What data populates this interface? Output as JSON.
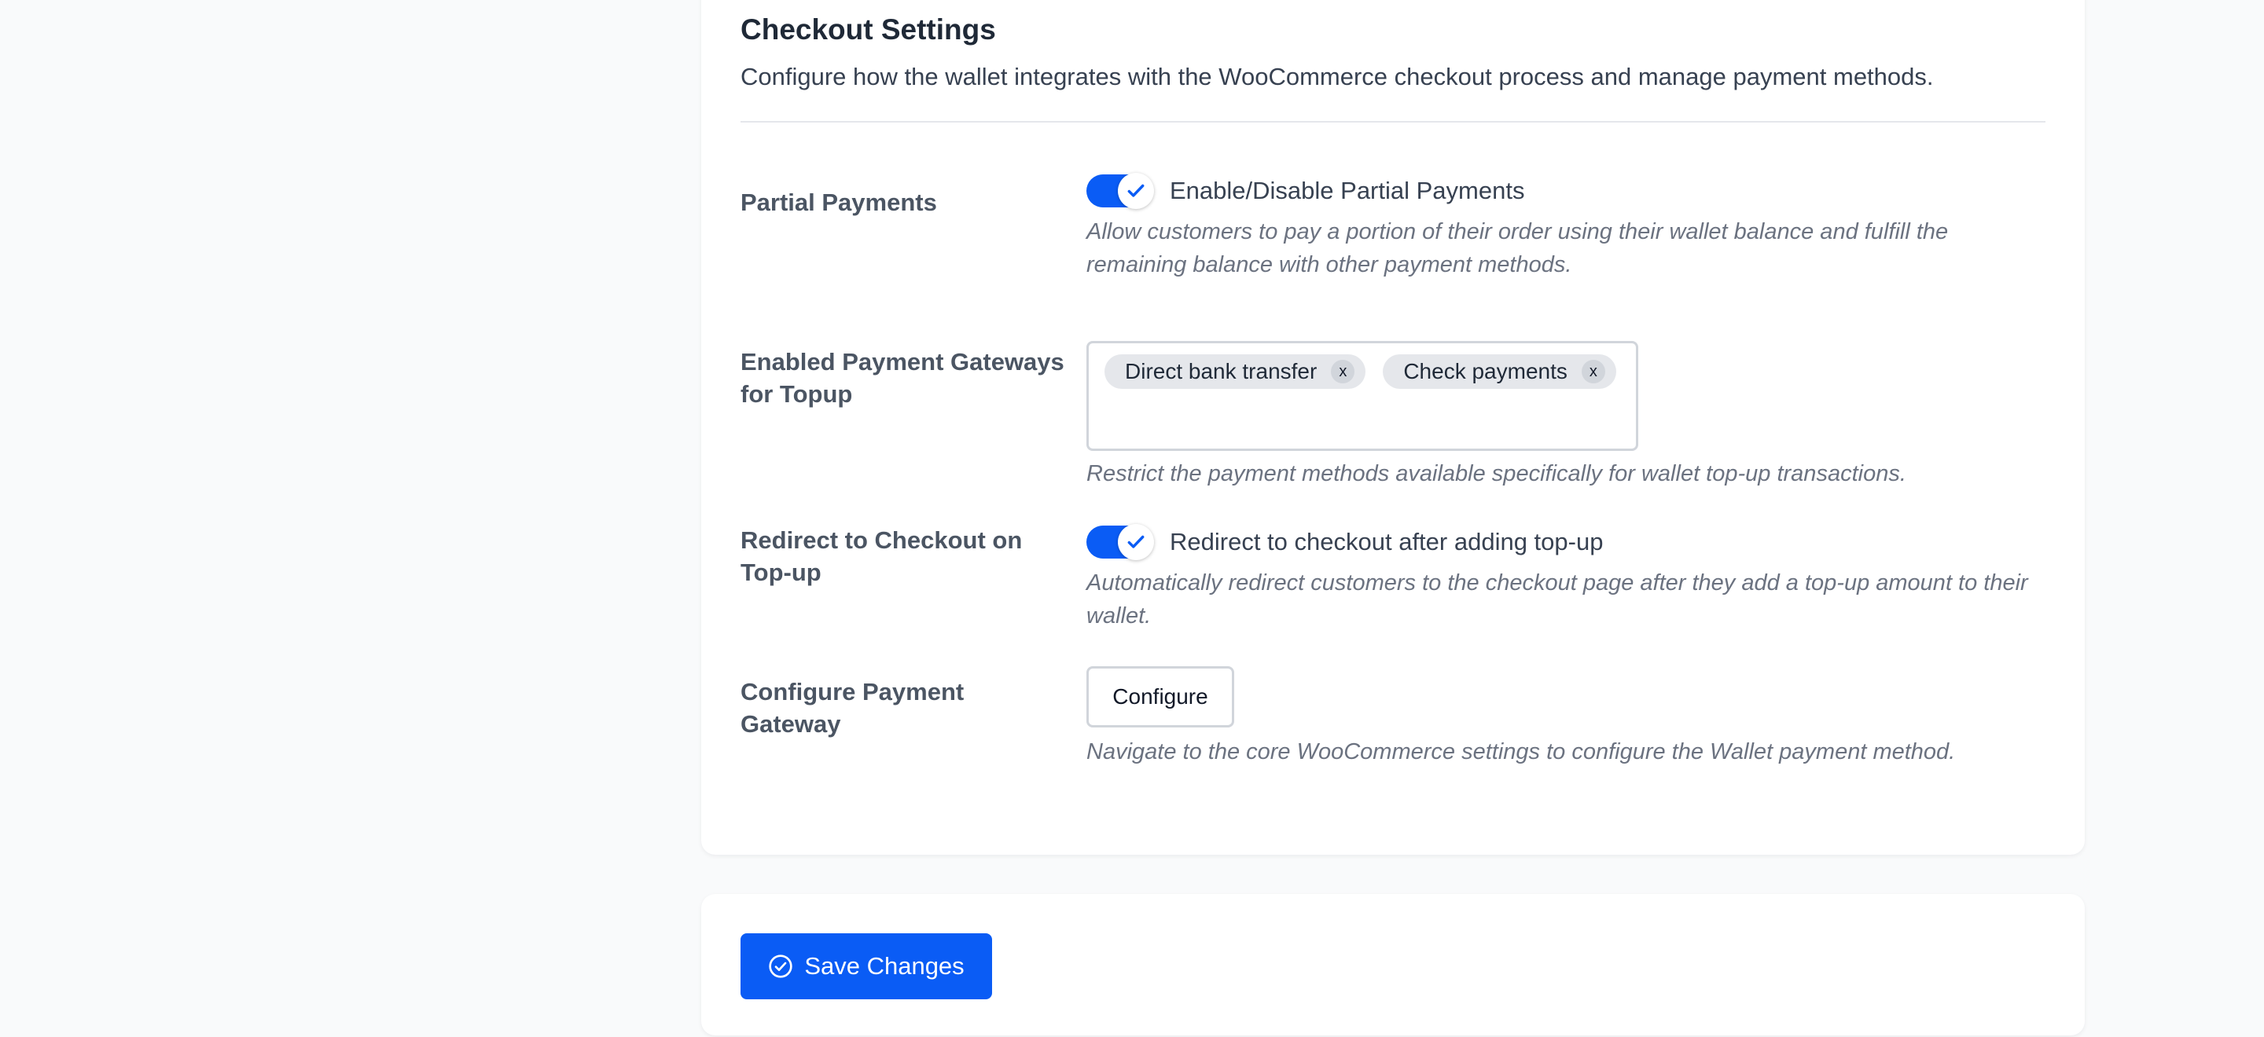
{
  "checkout_settings": {
    "title": "Checkout Settings",
    "description": "Configure how the wallet integrates with the WooCommerce checkout process and manage payment methods."
  },
  "settings": {
    "partial_payments": {
      "label": "Partial Payments",
      "toggle_label": "Enable/Disable Partial Payments",
      "enabled": true,
      "help": "Allow customers to pay a portion of their order using their wallet balance and fulfill the remaining balance with other payment methods."
    },
    "topup_gateways": {
      "label": "Enabled Payment Gateways for Topup",
      "selected": [
        {
          "label": "Direct bank transfer",
          "remove": "x"
        },
        {
          "label": "Check payments",
          "remove": "x"
        }
      ],
      "help": "Restrict the payment methods available specifically for wallet top-up transactions."
    },
    "redirect_checkout": {
      "label": "Redirect to Checkout on Top-up",
      "toggle_label": "Redirect to checkout after adding top-up",
      "enabled": true,
      "help": "Automatically redirect customers to the checkout page after they add a top-up amount to their wallet."
    },
    "configure_gateway": {
      "label": "Configure Payment Gateway",
      "button_label": "Configure",
      "help": "Navigate to the core WooCommerce settings to configure the Wallet payment method."
    }
  },
  "actions": {
    "save_label": "Save Changes",
    "save_icon": "check-circle-icon"
  },
  "colors": {
    "accent": "#0a5cf5",
    "background": "#f9fafb",
    "card": "#ffffff"
  }
}
